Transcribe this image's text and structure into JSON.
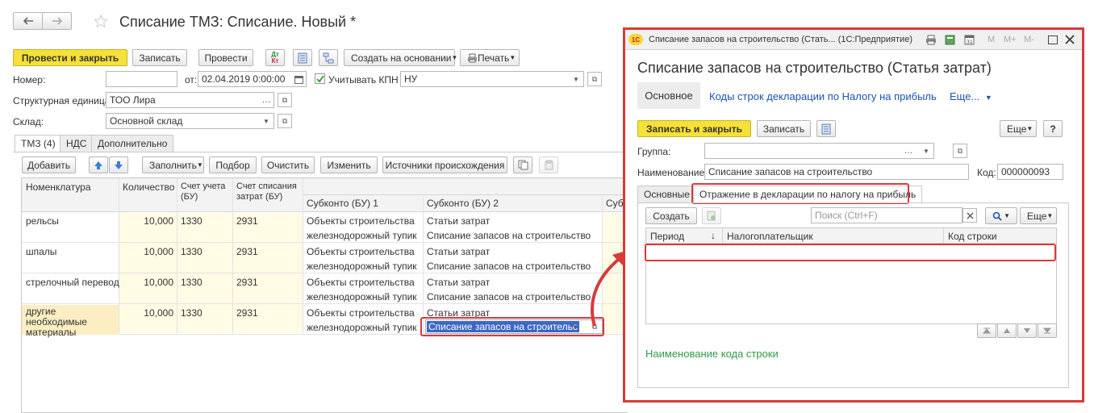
{
  "main": {
    "title": "Списание ТМЗ: Списание. Новый *",
    "toolbar": {
      "post_close": "Провести и закрыть",
      "save": "Записать",
      "post": "Провести",
      "dt_kt_top": "Дт",
      "dt_kt_bottom": "Кт",
      "create_based": "Создать на основании",
      "print": "Печать"
    },
    "fields": {
      "number_label": "Номер:",
      "number_value": "",
      "date_label": "от:",
      "date_value": "02.04.2019  0:00:00",
      "kpn_label": "Учитывать КПН",
      "kpn_checked": true,
      "kpn_value": "НУ",
      "unit_label": "Структурная единица:",
      "unit_value": "ТОО Лира",
      "warehouse_label": "Склад:",
      "warehouse_value": "Основной склад"
    },
    "tabs": [
      "ТМЗ (4)",
      "НДС",
      "Дополнительно"
    ],
    "table_toolbar": {
      "add": "Добавить",
      "fill": "Заполнить",
      "select": "Подбор",
      "clear": "Очистить",
      "change": "Изменить",
      "sources": "Источники происхождения"
    },
    "columns": {
      "nomenclature": "Номенклатура",
      "quantity": "Количество",
      "account": "Счет учета (БУ)",
      "writeoff_account": "Счет списания затрат (БУ)",
      "subconto1": "Субконто (БУ) 1",
      "subconto2": "Субконто (БУ) 2",
      "subconto3": "Субк"
    },
    "rows": [
      {
        "name": "рельсы",
        "qty": "10,000",
        "acc": "1330",
        "wacc": "2931",
        "s1a": "Объекты строительства",
        "s1b": "железнодорожный тупик",
        "s2a": "Статьи затрат",
        "s2b": "Списание запасов на строительство"
      },
      {
        "name": "шпалы",
        "qty": "10,000",
        "acc": "1330",
        "wacc": "2931",
        "s1a": "Объекты строительства",
        "s1b": "железнодорожный тупик",
        "s2a": "Статьи затрат",
        "s2b": "Списание запасов на строительство"
      },
      {
        "name": "стрелочный перевод",
        "qty": "10,000",
        "acc": "1330",
        "wacc": "2931",
        "s1a": "Объекты строительства",
        "s1b": "железнодорожный тупик",
        "s2a": "Статьи затрат",
        "s2b": "Списание запасов на строительство"
      },
      {
        "name": "другие необходимые материалы",
        "qty": "10,000",
        "acc": "1330",
        "wacc": "2931",
        "s1a": "Объекты строительства",
        "s1b": "железнодорожный тупик",
        "s2a": "Статьи затрат",
        "s2b": "Списание запасов на строительс"
      }
    ]
  },
  "dialog": {
    "window_title": "Списание запасов на строительство (Стать... (1С:Предприятие)",
    "window_icons": [
      "M",
      "M+",
      "M-"
    ],
    "heading": "Списание запасов на строительство (Статья затрат)",
    "nav": {
      "main": "Основное",
      "link": "Коды строк декларации по Налогу на прибыль",
      "more": "Еще..."
    },
    "toolbar": {
      "save_close": "Записать и закрыть",
      "save": "Записать",
      "more": "Еще",
      "help": "?"
    },
    "fields": {
      "group_label": "Группа:",
      "group_value": "",
      "name_label": "Наименование:",
      "name_value": "Списание запасов на строительство",
      "code_label": "Код:",
      "code_value": "000000093"
    },
    "tabs": [
      "Основные",
      "Отражение в декларации по налогу на прибыль"
    ],
    "table_toolbar": {
      "create": "Создать",
      "search_placeholder": "Поиск (Ctrl+F)",
      "more": "Еще"
    },
    "columns": {
      "period": "Период",
      "taxpayer": "Налогоплательщик",
      "line_code": "Код строки"
    },
    "footer_link": "Наименование кода строки"
  },
  "colors": {
    "accent_yellow": "#f5e137",
    "highlight_red": "#d93a3a",
    "link_blue": "#1a55b0",
    "green_text": "#2e9b47",
    "selection_blue": "#3c67c4"
  }
}
